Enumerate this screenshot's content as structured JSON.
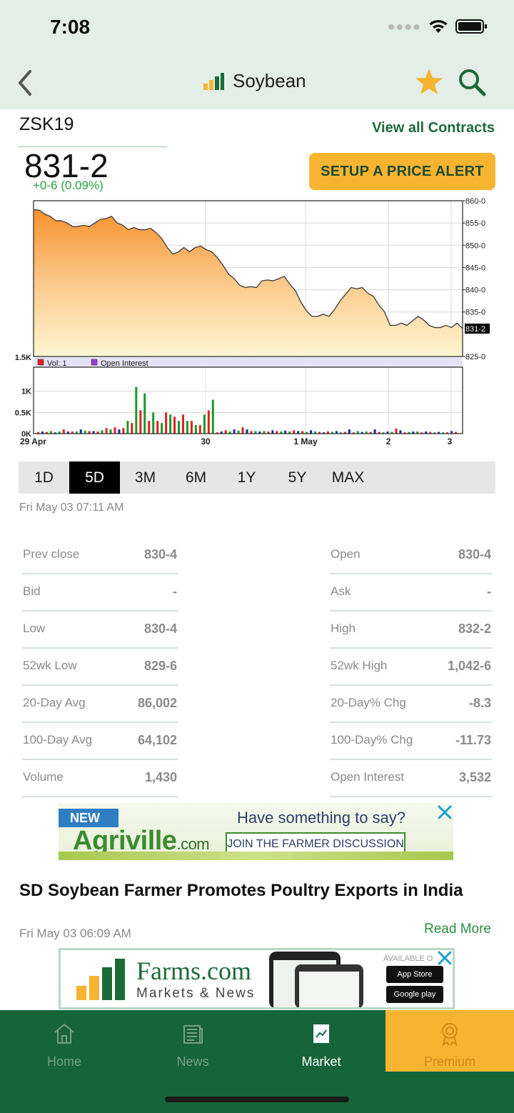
{
  "status": {
    "time": "7:08"
  },
  "nav": {
    "title": "Soybean"
  },
  "contract": {
    "code": "ZSK19",
    "view_all": "View all Contracts",
    "price": "831-2",
    "change": "+0-6 (0.09%)",
    "alert_button": "SETUP A PRICE ALERT"
  },
  "chart_data": {
    "type": "line",
    "x_ticks": [
      "29 Apr",
      "30",
      "1 May",
      "2",
      "3"
    ],
    "y_ticks": [
      "860-0",
      "855-0",
      "850-0",
      "845-0",
      "840-0",
      "835-0",
      "825-0"
    ],
    "ylim": [
      825,
      860
    ],
    "last_label": "831-2",
    "series": [
      {
        "values": [
          858,
          857.9,
          857,
          856.5,
          855.5,
          855.5,
          855,
          854.2,
          854.2,
          854.5,
          854.2,
          855,
          855.8,
          856,
          856.5,
          855,
          854.5,
          853.5,
          854,
          853.5,
          853.5,
          853.8,
          852.8,
          851.5,
          849.5,
          848,
          848.5,
          849.5,
          848.5,
          849.5,
          849.8,
          849,
          848.5,
          847.2,
          845.5,
          843.5,
          842.5,
          841,
          840.5,
          840.7,
          840.5,
          842,
          842.2,
          842,
          842.5,
          843,
          841.2,
          839.8,
          837.2,
          835.2,
          834,
          834,
          834.5,
          834,
          835.5,
          837.5,
          839,
          840.5,
          840.2,
          840.5,
          839.2,
          838.5,
          836.5,
          835,
          832,
          832,
          832.5,
          832,
          833,
          834,
          833.2,
          832,
          831.5,
          831.5,
          832,
          831.5,
          832.5,
          831.3
        ]
      }
    ],
    "volume_ticks": [
      "0K",
      "0.5K",
      "1K",
      "1.5K"
    ],
    "legend": [
      "Vol: 1",
      "Open Interest"
    ],
    "volume": [
      0.04,
      0.05,
      0.04,
      0.06,
      0.03,
      0.05,
      0.1,
      0.05,
      0.05,
      0.05,
      0.1,
      0.07,
      0.06,
      0.06,
      0.05,
      0.08,
      0.13,
      0.1,
      0.15,
      0.1,
      0.13,
      0.3,
      0.25,
      1.1,
      0.55,
      0.95,
      0.3,
      0.5,
      0.3,
      0.25,
      0.5,
      0.45,
      0.4,
      0.3,
      0.45,
      0.3,
      0.3,
      0.2,
      0.2,
      0.45,
      0.55,
      0.8,
      0.03,
      0.05,
      0.08,
      0.05,
      0.1,
      0.07,
      0.15,
      0.1,
      0.06,
      0.06,
      0.05,
      0.06,
      0.05,
      0.08,
      0.06,
      0.05,
      0.07,
      0.05,
      0.08,
      0.06,
      0.06,
      0.04,
      0.08,
      0.05,
      0.04,
      0.03,
      0.05,
      0.04,
      0.06,
      0.03,
      0.04,
      0.1,
      0.03,
      0.06,
      0.04,
      0.05,
      0.04,
      0.1,
      0.04,
      0.03,
      0.05,
      0.04,
      0.12,
      0.08,
      0.03,
      0.04,
      0.05,
      0.05,
      0.03,
      0.05,
      0.04,
      0.03,
      0.04,
      0.03,
      0.03,
      0.06,
      0.04
    ],
    "volume_colors": [
      "#dd2222",
      "#1a9a2a",
      "#1a2aa0"
    ]
  },
  "ranges": [
    "1D",
    "5D",
    "3M",
    "6M",
    "1Y",
    "5Y",
    "MAX"
  ],
  "active_range": "5D",
  "timestamp": "Fri May 03 07:11 AM",
  "stats_left": [
    {
      "label": "Prev close",
      "value": "830-4"
    },
    {
      "label": "Bid",
      "value": "-"
    },
    {
      "label": "Low",
      "value": "830-4"
    },
    {
      "label": "52wk Low",
      "value": "829-6"
    },
    {
      "label": "20-Day Avg",
      "value": "86,002"
    },
    {
      "label": "100-Day Avg",
      "value": "64,102"
    },
    {
      "label": "Volume",
      "value": "1,430"
    }
  ],
  "stats_right": [
    {
      "label": "Open",
      "value": "830-4"
    },
    {
      "label": "Ask",
      "value": "-"
    },
    {
      "label": "High",
      "value": "832-2"
    },
    {
      "label": "52wk High",
      "value": "1,042-6"
    },
    {
      "label": "20-Day% Chg",
      "value": "-8.3"
    },
    {
      "label": "100-Day% Chg",
      "value": "-11.73"
    },
    {
      "label": "Open Interest",
      "value": "3,532"
    }
  ],
  "ad1": {
    "badge": "NEW",
    "brand": "Agriville",
    "brand_suffix": ".com",
    "headline": "Have something to say?",
    "cta": "JOIN THE FARMER DISCUSSION"
  },
  "news": {
    "headline": "SD Soybean Farmer Promotes Poultry Exports in India",
    "time": "Fri May 03 06:09 AM",
    "read_more": "Read More"
  },
  "ad2": {
    "title": "Farms.com",
    "subtitle": "Markets & News",
    "available": "AVAILABLE O",
    "app_store": "App Store",
    "google_play": "Google play"
  },
  "tabs": [
    {
      "label": "Home",
      "icon": "home-icon"
    },
    {
      "label": "News",
      "icon": "news-icon"
    },
    {
      "label": "Market",
      "icon": "market-icon"
    },
    {
      "label": "Premium",
      "icon": "premium-icon"
    }
  ],
  "colors": {
    "brand_green": "#16643a",
    "accent_gold": "#f6b431",
    "positive": "#27a03f"
  }
}
